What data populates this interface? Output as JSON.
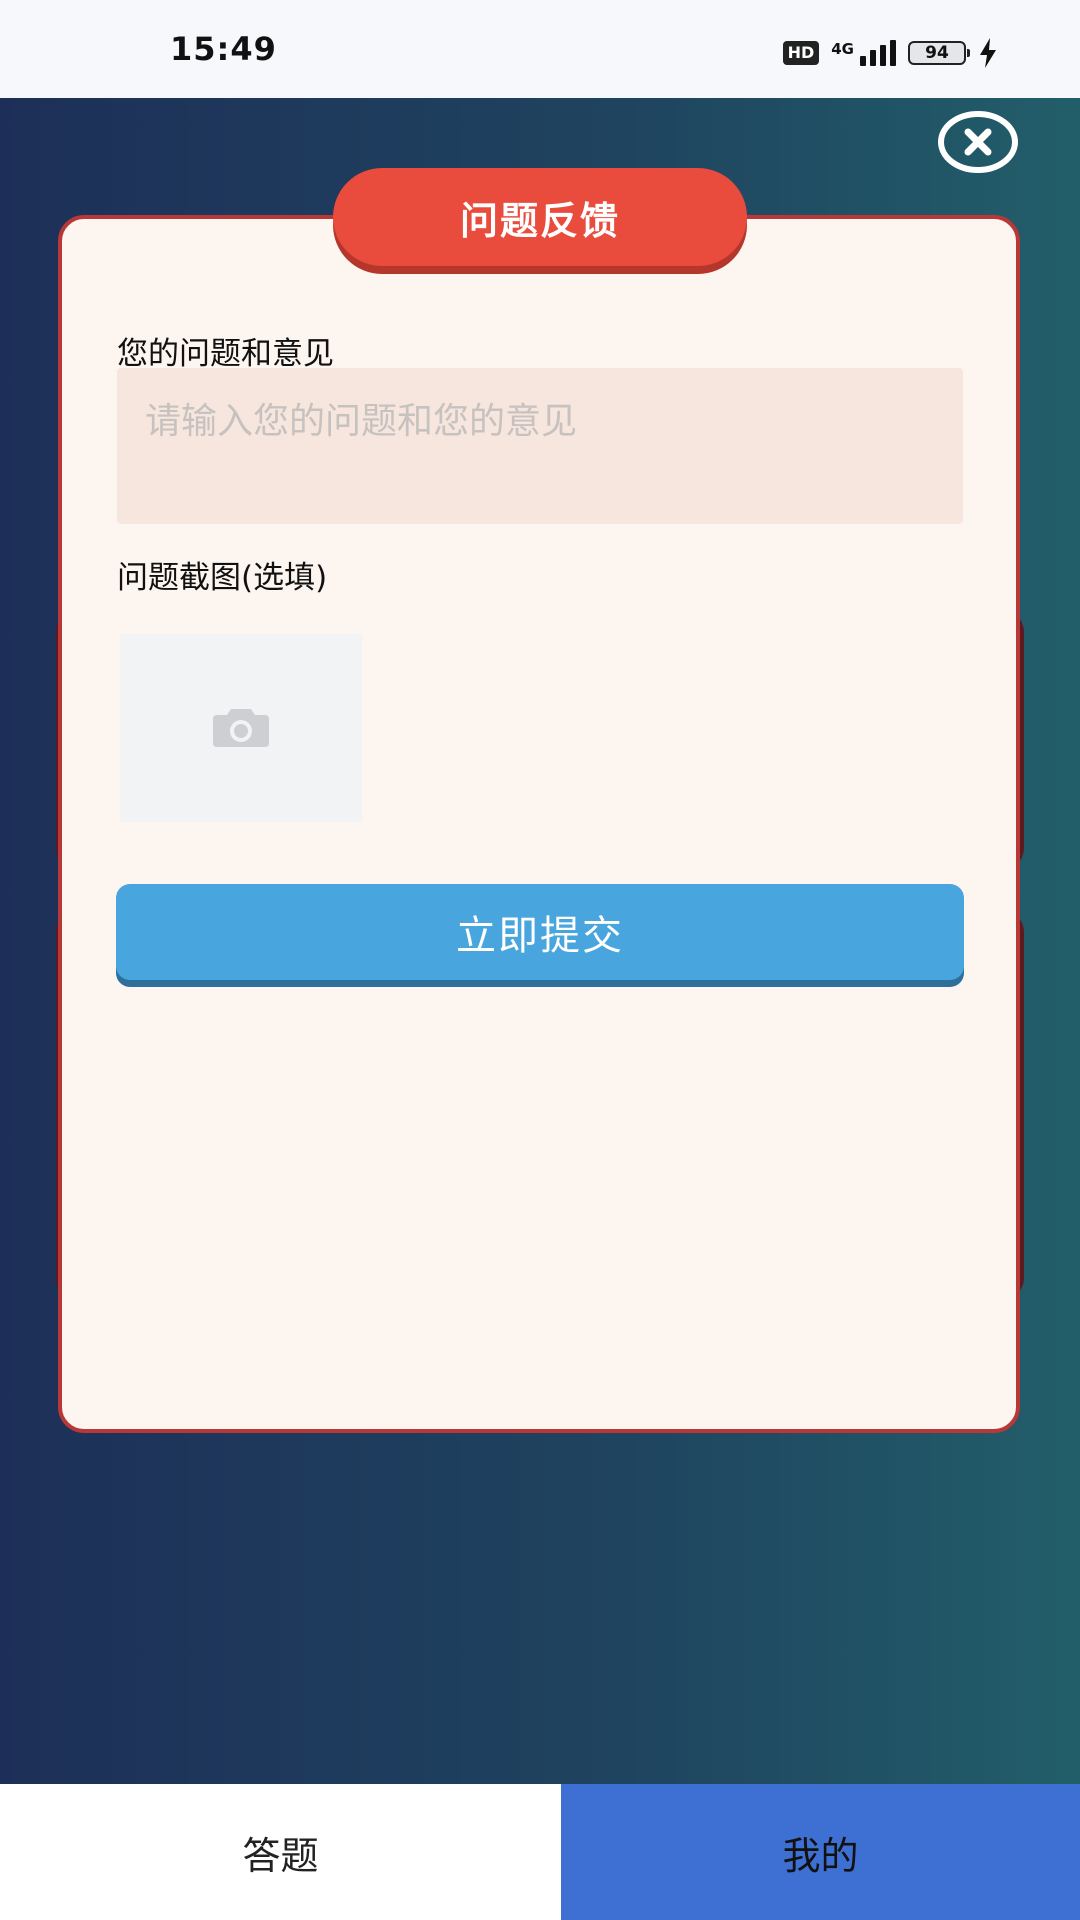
{
  "status_bar": {
    "time": "15:49",
    "hd": "HD",
    "network": "4G",
    "battery": "94"
  },
  "dialog": {
    "title": "问题反馈",
    "feedback_label": "您的问题和意见",
    "feedback_placeholder": "请输入您的问题和您的意见",
    "screenshot_label": "问题截图(选填)",
    "submit_label": "立即提交"
  },
  "tabs": [
    {
      "label": "答题",
      "active": false
    },
    {
      "label": "我的",
      "active": true
    }
  ],
  "icons": {
    "close": "close-circle-icon",
    "camera": "camera-icon",
    "charging": "lightning-icon"
  },
  "colors": {
    "title_pill": "#e94b3c",
    "dialog_border": "#b83838",
    "submit_button": "#48a5de",
    "active_tab": "#3e70d4"
  }
}
